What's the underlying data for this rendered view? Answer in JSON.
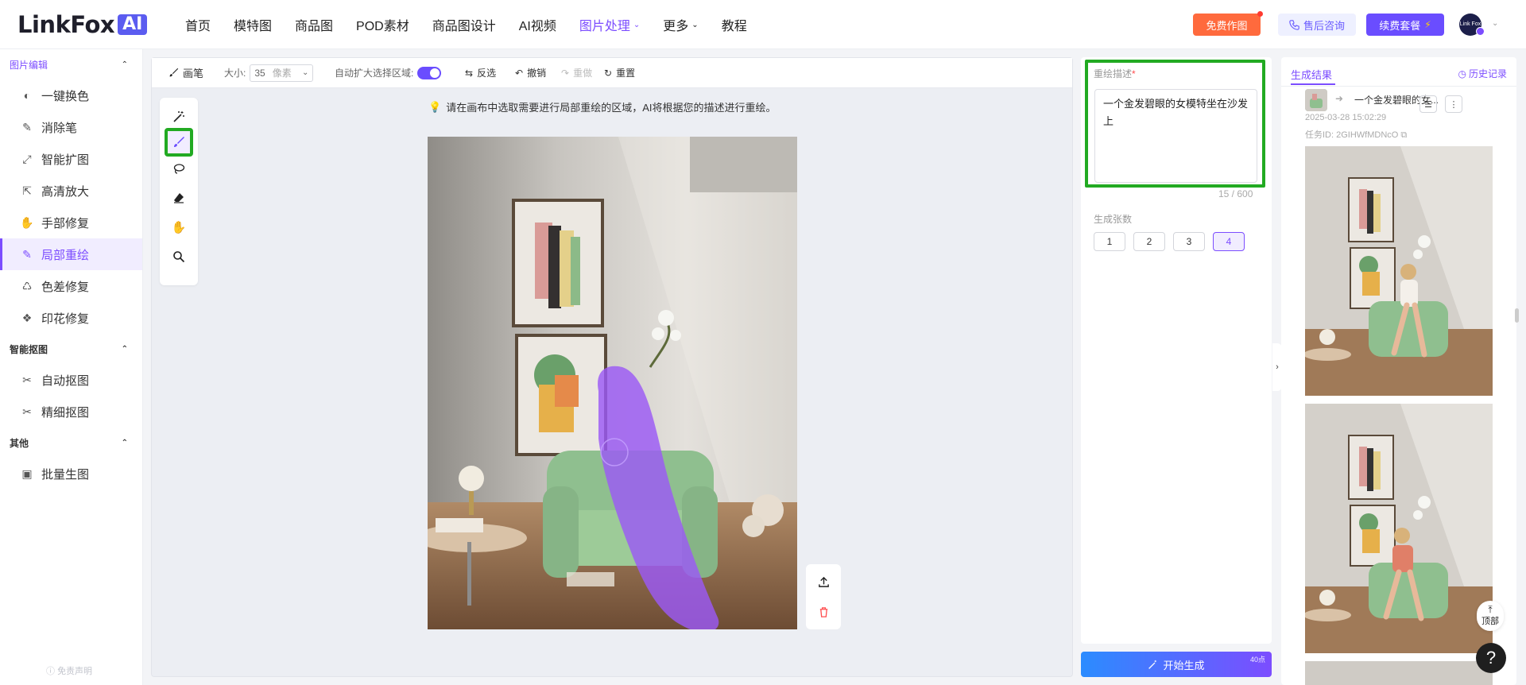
{
  "brand": {
    "logo_text": "LinkFox",
    "logo_ai": "AI"
  },
  "nav": {
    "items": [
      {
        "label": "首页"
      },
      {
        "label": "模特图"
      },
      {
        "label": "商品图"
      },
      {
        "label": "POD素材"
      },
      {
        "label": "商品图设计"
      },
      {
        "label": "AI视频"
      },
      {
        "label": "图片处理",
        "active": true
      },
      {
        "label": "更多"
      },
      {
        "label": "教程"
      }
    ],
    "free_btn": "免费作图",
    "support_btn": "售后咨询",
    "renew_btn": "续费套餐",
    "avatar_text": "Link Fox"
  },
  "sidebar": {
    "section_edit": "图片编辑",
    "edit_items": [
      {
        "label": "一键换色",
        "icon": "color-swap-icon"
      },
      {
        "label": "消除笔",
        "icon": "eraser-pen-icon"
      },
      {
        "label": "智能扩图",
        "icon": "expand-icon"
      },
      {
        "label": "高清放大",
        "icon": "upscale-icon"
      },
      {
        "label": "手部修复",
        "icon": "hand-icon"
      },
      {
        "label": "局部重绘",
        "icon": "repaint-icon",
        "active": true
      },
      {
        "label": "色差修复",
        "icon": "color-fix-icon"
      },
      {
        "label": "印花修复",
        "icon": "print-fix-icon"
      }
    ],
    "section_cutout": "智能抠图",
    "cutout_items": [
      {
        "label": "自动抠图",
        "icon": "auto-cutout-icon"
      },
      {
        "label": "精细抠图",
        "icon": "fine-cutout-icon"
      }
    ],
    "section_other": "其他",
    "other_items": [
      {
        "label": "批量生图",
        "icon": "batch-image-icon"
      }
    ],
    "footer": "免责声明"
  },
  "toolbar": {
    "brush_label": "画笔",
    "size_label": "大小:",
    "size_value": "35",
    "size_unit": "像素",
    "auto_expand_label": "自动扩大选择区域:",
    "auto_expand_on": true,
    "invert_label": "反选",
    "undo_label": "撤销",
    "redo_label": "重做",
    "reset_label": "重置"
  },
  "canvas": {
    "hint": "请在画布中选取需要进行局部重绘的区域，AI将根据您的描述进行重绘。"
  },
  "description": {
    "label": "重绘描述",
    "required_mark": "*",
    "text": "一个金发碧眼的女模特坐在沙发上",
    "count": "15 / 600"
  },
  "gen_count": {
    "label": "生成张数",
    "options": [
      "1",
      "2",
      "3",
      "4"
    ],
    "selected": "4"
  },
  "generate": {
    "label": "开始生成",
    "points": "40点"
  },
  "results": {
    "tab_label": "生成结果",
    "history_label": "历史记录",
    "item_title": "一个金发碧眼的女...",
    "date": "2025-03-28 15:02:29",
    "task_id": "任务ID: 2GIHWfMDNcO",
    "top_label": "顶部",
    "help_label": "?"
  },
  "colors": {
    "accent": "#7c4dff",
    "highlight_box": "#22aa22",
    "mask": "#9b59f5"
  }
}
